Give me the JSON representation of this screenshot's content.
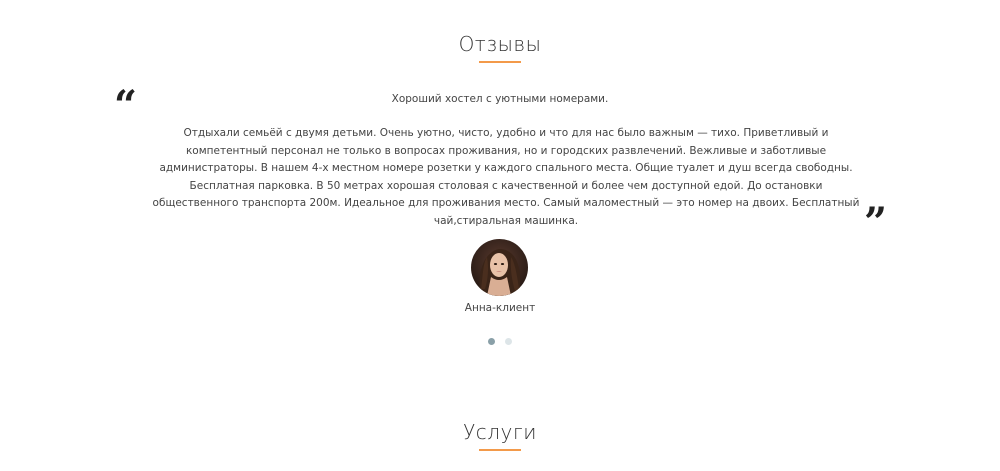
{
  "reviews_section": {
    "title": "Отзывы",
    "active_slide": 0,
    "slide_count": 2,
    "review": {
      "headline": "Хороший хостел с уютными номерами.",
      "body": "Отдыхали семьёй с двумя детьми. Очень уютно, чисто, удобно и что для нас было важным — тихо. Приветливый и компетентный персонал не только в вопросах проживания, но и городских развлечений. Вежливые и заботливые администраторы. В нашем 4-х местном номере розетки у каждого спального места. Общие туалет и душ всегда свободны. Бесплатная парковка. В 50 метрах хорошая столовая с качественной и более чем доступной едой. До остановки общественного транспорта 200м. Идеальное для проживания место. Самый маломестный — это номер на двоих. Бесплатный чай,стиральная машинка.",
      "author": "Анна-клиент",
      "open_quote": "“",
      "close_quote": "”"
    }
  },
  "services_section": {
    "title": "Услуги"
  },
  "colors": {
    "accent": "#f39a4a",
    "text": "#444444",
    "dot_active": "#8aa0a8",
    "dot_inactive": "#dde5e8"
  },
  "icons": {
    "open_quote": "open-quote-icon",
    "close_quote": "close-quote-icon"
  }
}
